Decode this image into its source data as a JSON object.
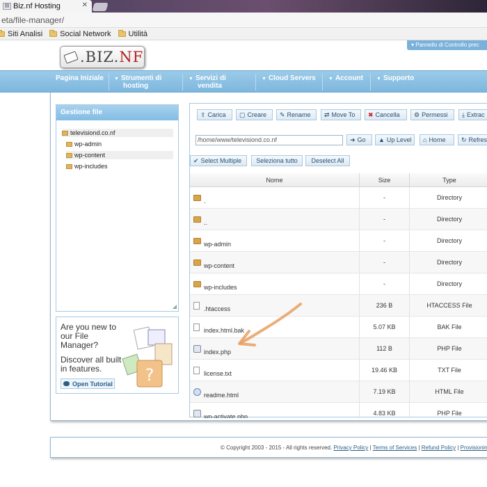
{
  "browser": {
    "tab_title": "Biz.nf Hosting",
    "url": "eta/file-manager/",
    "bookmarks": [
      "Siti Analisi",
      "Social Network",
      "Utilità"
    ]
  },
  "site": {
    "logo_main": ".BIZ.",
    "logo_accent": "NF",
    "control_panel": "Pannello di Controllo prec",
    "nav": [
      {
        "line1": "Pagina Iniziale",
        "line2": ""
      },
      {
        "line1": "Strumenti di",
        "line2": "hosting"
      },
      {
        "line1": "Servizi di",
        "line2": "vendita"
      },
      {
        "line1": "Cloud Servers",
        "line2": ""
      },
      {
        "line1": "Account",
        "line2": ""
      },
      {
        "line1": "Supporto",
        "line2": ""
      }
    ]
  },
  "left_panel": {
    "title": "Gestione file",
    "tree": [
      "televisiond.co.nf",
      "wp-admin",
      "wp-content",
      "wp-includes"
    ]
  },
  "help_box": {
    "text1": "Are you new to our File Manager?",
    "text2": "Discover all built in features.",
    "button": "Open Tutorial"
  },
  "toolbar": {
    "buttons": [
      "Carica",
      "Creare",
      "Rename",
      "Move To",
      "Cancella",
      "Permessi",
      "Extrac"
    ],
    "path_value": "/home/www/televisiond.co.nf",
    "nav_buttons": [
      "Go",
      "Up Level",
      "Home",
      "Refres"
    ],
    "select_buttons": [
      "Select Multiple",
      "Seleziona tutto",
      "Deselect All"
    ]
  },
  "table": {
    "columns": [
      "Nome",
      "Size",
      "Type"
    ],
    "rows": [
      {
        "name": ".",
        "size": "-",
        "type": "Directory",
        "icon": "folder-icon"
      },
      {
        "name": "..",
        "size": "-",
        "type": "Directory",
        "icon": "folder-icon"
      },
      {
        "name": "wp-admin",
        "size": "-",
        "type": "Directory",
        "icon": "folder-icon"
      },
      {
        "name": "wp-content",
        "size": "-",
        "type": "Directory",
        "icon": "folder-icon"
      },
      {
        "name": "wp-includes",
        "size": "-",
        "type": "Directory",
        "icon": "folder-icon"
      },
      {
        "name": ".htaccess",
        "size": "236 B",
        "type": "HTACCESS File",
        "icon": "file-icon"
      },
      {
        "name": "index.html.bak",
        "size": "5.07 KB",
        "type": "BAK File",
        "icon": "file-icon"
      },
      {
        "name": "index.php",
        "size": "112 B",
        "type": "PHP File",
        "icon": "php-icon"
      },
      {
        "name": "license.txt",
        "size": "19.46 KB",
        "type": "TXT File",
        "icon": "file-icon"
      },
      {
        "name": "readme.html",
        "size": "7.19 KB",
        "type": "HTML File",
        "icon": "html-icon"
      },
      {
        "name": "wp-activate.php",
        "size": "4.83 KB",
        "type": "PHP File",
        "icon": "php-icon"
      }
    ]
  },
  "footer": {
    "copyright": "© Copyright 2003 - 2015 - All rights reserved.",
    "links": [
      "Privacy Policy",
      "Terms of Services",
      "Refund Policy",
      "Provisioning & Inv"
    ]
  },
  "colors": {
    "nav_blue": "#7db7de",
    "accent_red": "#b3201e",
    "annotation_arrow": "#e8a060"
  }
}
